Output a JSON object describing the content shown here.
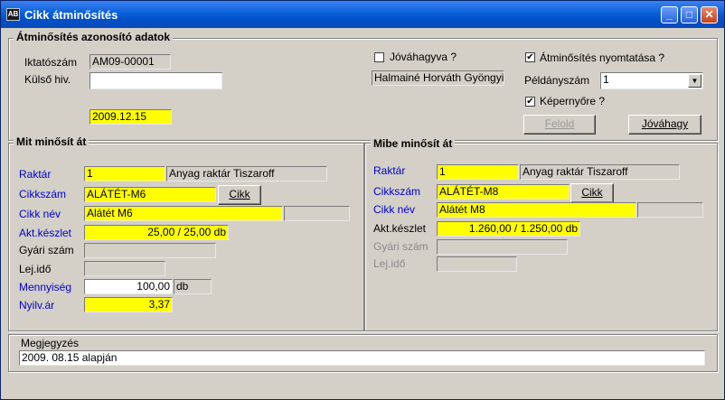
{
  "window": {
    "title": "Cikk átminősítés",
    "icon": "app-icon",
    "min": "_",
    "max": "□",
    "close": "✕"
  },
  "id_group": {
    "title": "Átminősítés azonosító adatok",
    "iktatoszam_label": "Iktatószám",
    "iktatoszam_value": "AM09-00001",
    "kulso_label": "Külső hiv.",
    "kulso_value": "",
    "date": "2009.12.15",
    "jovahagyva_label": "Jóváhagyva ?",
    "jovahagyva_checked": false,
    "approver": "Halmainé Horváth Gyöngyi",
    "nyomtatas_label": "Átminősítés nyomtatása ?",
    "nyomtatas_checked": true,
    "peldanyszam_label": "Példányszám",
    "peldanyszam_value": "1",
    "kepernyore_label": "Képernyőre ?",
    "kepernyore_checked": true,
    "felold_label": "Felold",
    "jovahagy_label": "Jóváhagy"
  },
  "from": {
    "title": "Mit minősít át",
    "raktar_label": "Raktár",
    "raktar_code": "1",
    "raktar_name": "Anyag raktár Tiszaroff",
    "cikkszam_label": "Cikkszám",
    "cikkszam": "ALÁTÉT-M6",
    "cikk_btn": "Cikk",
    "cikknev_label": "Cikk név",
    "cikknev": "Alátét M6",
    "akt_label": "Akt.készlet",
    "akt_value": "25,00 / 25,00 db",
    "gyari_label": "Gyári szám",
    "lejido_label": "Lej.idő",
    "mennyiseg_label": "Mennyiség",
    "mennyiseg_value": "100,00",
    "mennyiseg_unit": "db",
    "nyilvar_label": "Nyilv.ár",
    "nyilvar_value": "3,37"
  },
  "to": {
    "title": "Mibe minősít át",
    "raktar_label": "Raktár",
    "raktar_code": "1",
    "raktar_name": "Anyag raktár Tiszaroff",
    "cikkszam_label": "Cikkszám",
    "cikkszam": "ALÁTÉT-M8",
    "cikk_btn": "Cikk",
    "cikknev_label": "Cikk név",
    "cikknev": "Alátét M8",
    "akt_label": "Akt.készlet",
    "akt_value": "1.260,00 / 1.250,00 db",
    "gyari_label": "Gyári szám",
    "lejido_label": "Lej.idő"
  },
  "note": {
    "label": "Megjegyzés",
    "value": "2009. 08.15 alapján"
  },
  "colors": {
    "title_bar": "#0a5fd8",
    "highlight": "#ffff00",
    "label_blue": "#0000c8"
  }
}
